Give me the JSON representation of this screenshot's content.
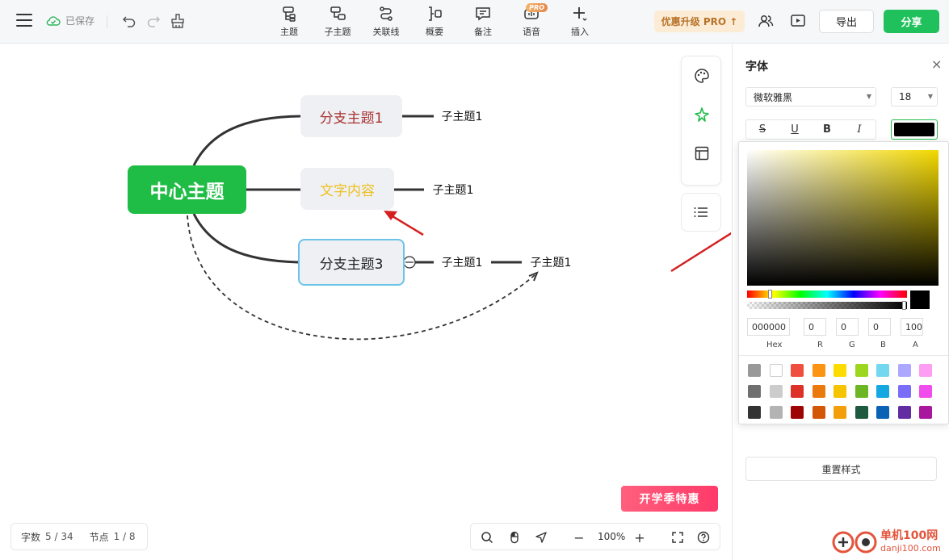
{
  "header": {
    "saved_label": "已保存",
    "tools": [
      {
        "label": "主题",
        "icon": "topic-icon"
      },
      {
        "label": "子主题",
        "icon": "subtopic-icon"
      },
      {
        "label": "关联线",
        "icon": "relation-line-icon"
      },
      {
        "label": "概要",
        "icon": "summary-icon"
      },
      {
        "label": "备注",
        "icon": "note-icon"
      },
      {
        "label": "语音",
        "icon": "voice-icon",
        "badge": "PRO"
      },
      {
        "label": "插入",
        "icon": "insert-icon"
      }
    ],
    "upgrade_label": "优惠升级 PRO ↑",
    "export_label": "导出",
    "share_label": "分享",
    "accent_color": "#20c05c"
  },
  "mindmap": {
    "root": "中心主题",
    "branches": [
      {
        "label": "分支主题1",
        "color": "#a83232",
        "children": [
          "子主题1"
        ]
      },
      {
        "label": "文字内容",
        "color": "#f0c020",
        "children": [
          "子主题1"
        ]
      },
      {
        "label": "分支主题3",
        "color": "#222222",
        "children": [
          "子主题1"
        ],
        "selected": true
      }
    ],
    "floating_node": "子主题1"
  },
  "promo_label": "开学季特惠",
  "status": {
    "words_label": "字数",
    "words_value": "5 / 34",
    "nodes_label": "节点",
    "nodes_value": "1 / 8"
  },
  "zoom": {
    "value": "100%",
    "minus": "−",
    "plus": "+"
  },
  "panel": {
    "title": "字体",
    "close": "×",
    "font_family": "微软雅黑",
    "font_size": "18",
    "styles": [
      "S",
      "U",
      "B",
      "I"
    ],
    "font_color": "#000000",
    "reset_label": "重置样式"
  },
  "picker": {
    "hex": "000000",
    "r": "0",
    "g": "0",
    "b": "0",
    "a": "100",
    "labels": {
      "hex": "Hex",
      "r": "R",
      "g": "G",
      "b": "B",
      "a": "A"
    },
    "palette": [
      "#999999",
      "#ffffff",
      "#f04e3e",
      "#fb9412",
      "#fcdb00",
      "#9cd61e",
      "#72d7ef",
      "#aca8ff",
      "#fd9ef3",
      "#6f6f6f",
      "#cccccc",
      "#dd3127",
      "#ea7a0b",
      "#f5c300",
      "#6cb623",
      "#15a7e1",
      "#7a6df8",
      "#f14dec",
      "#333333",
      "#b3b3b3",
      "#9d0404",
      "#d25706",
      "#f29f0b",
      "#1d5a40",
      "#0962b4",
      "#622ca3",
      "#a9179e"
    ]
  },
  "watermark": {
    "name": "单机100网",
    "url": "danji100.com"
  }
}
